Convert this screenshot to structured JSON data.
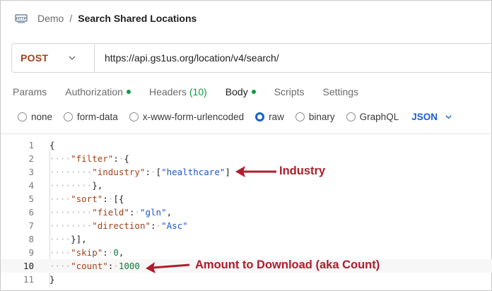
{
  "breadcrumb": {
    "collection": "Demo",
    "separator": "/",
    "request_name": "Search Shared Locations",
    "icon": "http-icon"
  },
  "request": {
    "method": "POST",
    "url": "https://api.gs1us.org/location/v4/search/"
  },
  "tabs": [
    {
      "label": "Params",
      "indicator": null
    },
    {
      "label": "Authorization",
      "indicator": "dot"
    },
    {
      "label": "Headers",
      "count": "(10)"
    },
    {
      "label": "Body",
      "indicator": "dot",
      "active": true
    },
    {
      "label": "Scripts"
    },
    {
      "label": "Settings"
    }
  ],
  "body_types": [
    {
      "label": "none",
      "checked": false
    },
    {
      "label": "form-data",
      "checked": false
    },
    {
      "label": "x-www-form-urlencoded",
      "checked": false
    },
    {
      "label": "raw",
      "checked": true
    },
    {
      "label": "binary",
      "checked": false
    },
    {
      "label": "GraphQL",
      "checked": false
    }
  ],
  "language": "JSON",
  "editor": {
    "line_numbers": [
      "1",
      "2",
      "3",
      "4",
      "5",
      "6",
      "7",
      "8",
      "9",
      "10",
      "11"
    ],
    "current_line": 10,
    "tokens": {
      "open_brace": "{",
      "filter_key": "\"filter\"",
      "industry_key": "\"industry\"",
      "industry_value": "\"healthcare\"",
      "sort_key": "\"sort\"",
      "field_key": "\"field\"",
      "field_value": "\"gln\"",
      "direction_key": "\"direction\"",
      "direction_value": "\"Asc\"",
      "skip_key": "\"skip\"",
      "skip_value": "0",
      "count_key": "\"count\"",
      "count_value": "1000",
      "close_brace": "}"
    }
  },
  "annotations": {
    "industry": "Industry",
    "count": "Amount to Download (aka Count)",
    "color": "#b01c2a"
  },
  "colors": {
    "method": "#a0421a",
    "accent_blue": "#1a5fd1",
    "status_green": "#0b9d3f",
    "json_key": "#a0421a",
    "json_string": "#1f57c3",
    "json_number": "#0f7b3a"
  }
}
